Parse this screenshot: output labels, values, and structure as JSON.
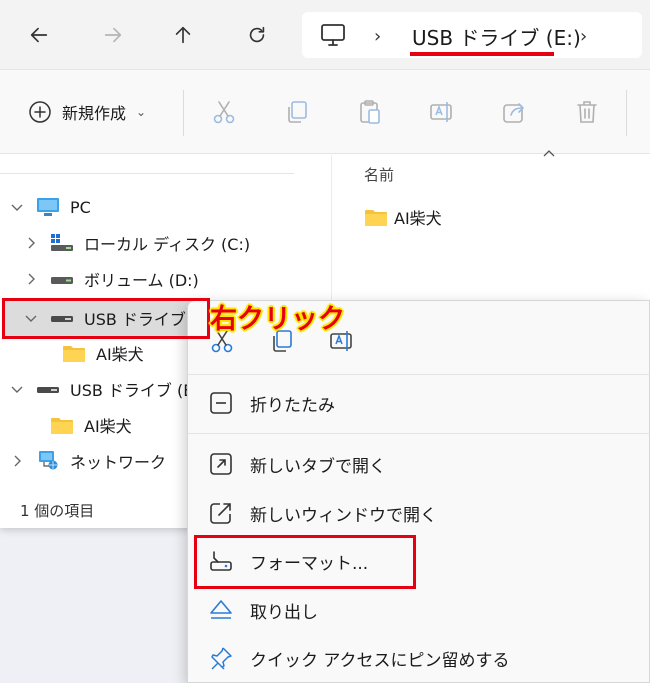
{
  "nav": {
    "back_icon": "arrow-left-icon",
    "forward_icon": "arrow-right-icon",
    "up_icon": "arrow-up-icon",
    "refresh_icon": "refresh-icon"
  },
  "address": {
    "pc_icon": "monitor-icon",
    "separator": "›",
    "current": "USB ドライブ (E:)"
  },
  "toolbar": {
    "new_label": "新規作成",
    "new_caret": "⌄",
    "buttons": [
      "cut-icon",
      "copy-icon",
      "paste-icon",
      "rename-icon",
      "share-icon",
      "delete-icon"
    ]
  },
  "sidebar": {
    "items": [
      {
        "label": "PC",
        "icon": "pc-icon",
        "expanded": true
      },
      {
        "label": "ローカル ディスク (C:)",
        "icon": "local-disk-icon"
      },
      {
        "label": "ボリューム (D:)",
        "icon": "drive-icon"
      },
      {
        "label": "USB ドライブ (E",
        "icon": "usb-drive-icon",
        "expanded": true,
        "selected": true
      },
      {
        "label": "AI柴犬",
        "icon": "folder-icon"
      },
      {
        "label": "USB ドライブ (E:)",
        "icon": "usb-drive-icon",
        "expanded": true
      },
      {
        "label": "AI柴犬",
        "icon": "folder-icon"
      },
      {
        "label": "ネットワーク",
        "icon": "network-icon"
      }
    ],
    "status": "1 個の項目"
  },
  "content": {
    "column_name": "名前",
    "items": [
      {
        "label": "AI柴犬",
        "icon": "folder-icon"
      }
    ]
  },
  "annotation": "右クリック",
  "context_menu": {
    "quick_actions": [
      "cut-icon",
      "copy-icon",
      "rename-icon"
    ],
    "items": [
      {
        "label": "折りたたみ",
        "icon": "collapse-icon"
      },
      {
        "label": "新しいタブで開く",
        "icon": "open-new-tab-icon"
      },
      {
        "label": "新しいウィンドウで開く",
        "icon": "open-new-window-icon"
      },
      {
        "label": "フォーマット...",
        "icon": "format-icon"
      },
      {
        "label": "取り出し",
        "icon": "eject-icon"
      },
      {
        "label": "クイック アクセスにピン留めする",
        "icon": "pin-icon"
      }
    ]
  },
  "colors": {
    "highlight_red": "#e60012",
    "annotation_glow": "#ffe500",
    "folder": "#f4c23b",
    "accent_blue": "#2b7bd6"
  }
}
